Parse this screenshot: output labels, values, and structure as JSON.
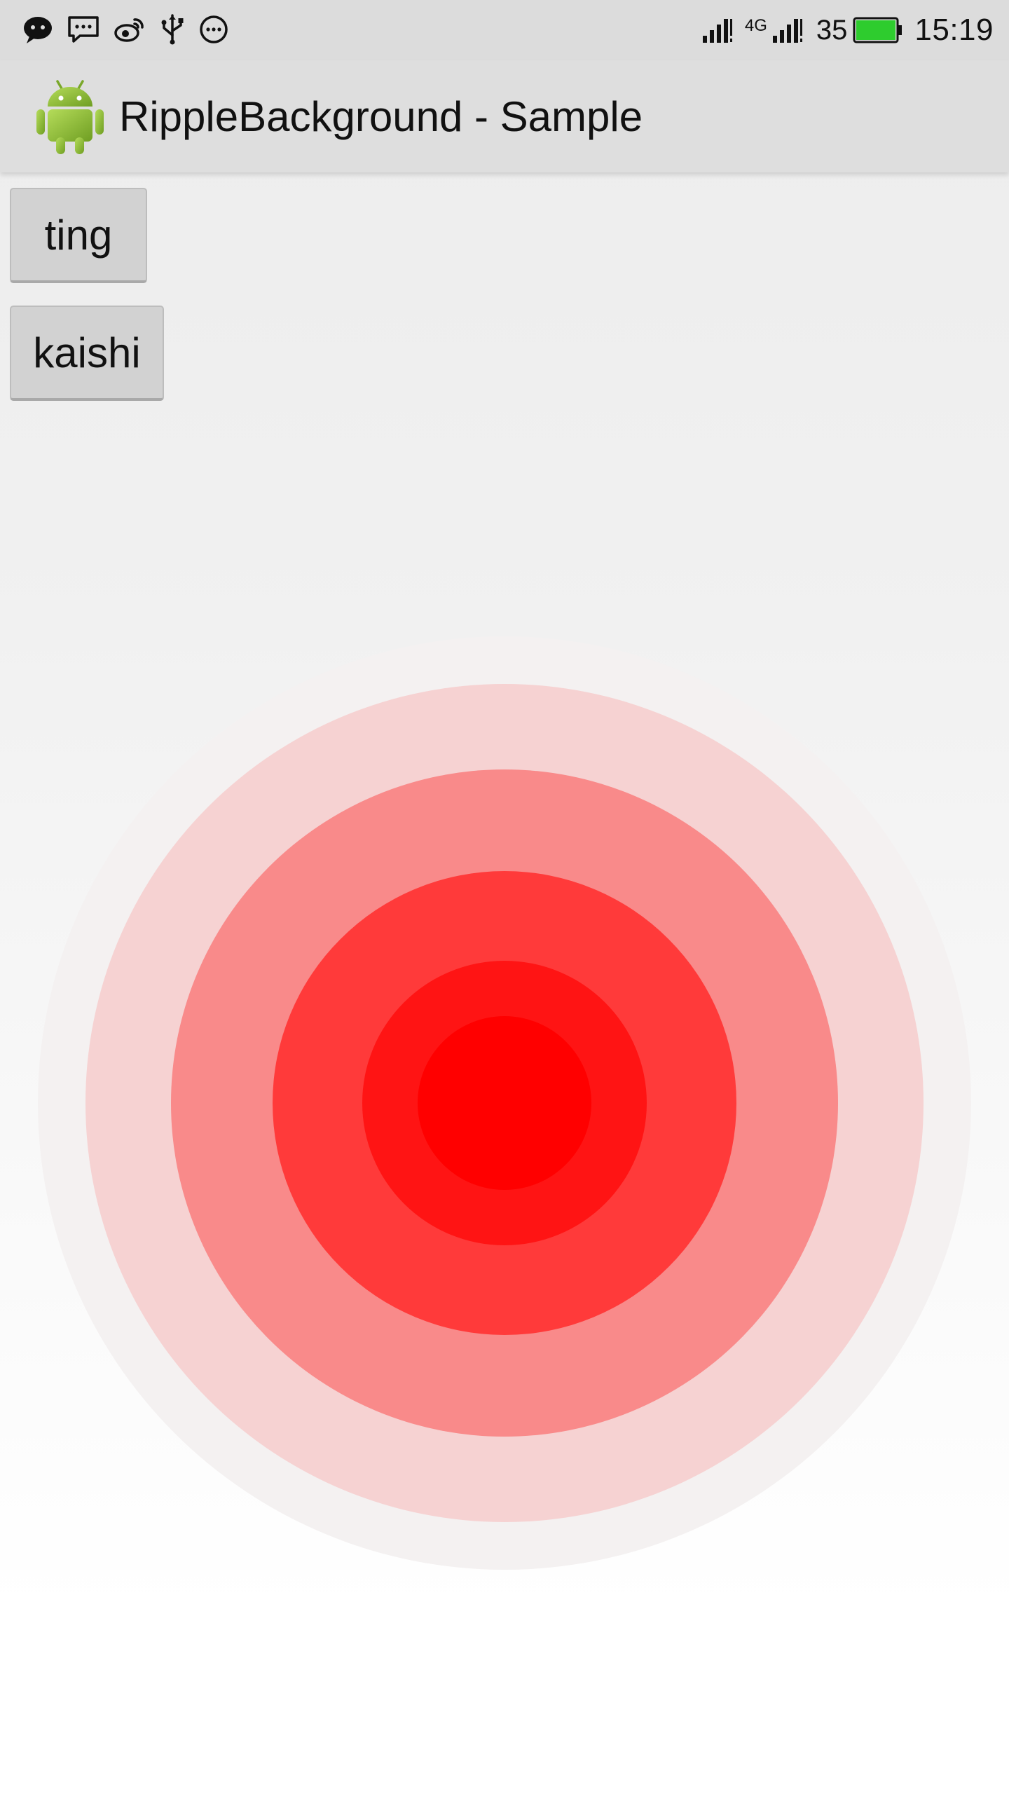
{
  "status_bar": {
    "left_icons": [
      "chat-bubble-icon",
      "message-icon",
      "weibo-icon",
      "usb-icon",
      "more-icon"
    ],
    "network_label": "4G",
    "battery_level": "35",
    "battery_fill_color": "#2ecc2e",
    "time": "15:19"
  },
  "action_bar": {
    "title": "RippleBackground - Sample",
    "app_icon": "android-robot-icon",
    "icon_color": "#8bc34a"
  },
  "buttons": {
    "ting_label": "ting",
    "kaishi_label": "kaishi"
  },
  "ripple": {
    "ring_count": 6,
    "ring_colors": [
      "#f4f1f1",
      "#f6d2d2",
      "#f98a8a",
      "#ff3a3a",
      "#ff1414",
      "#ff0000"
    ]
  }
}
